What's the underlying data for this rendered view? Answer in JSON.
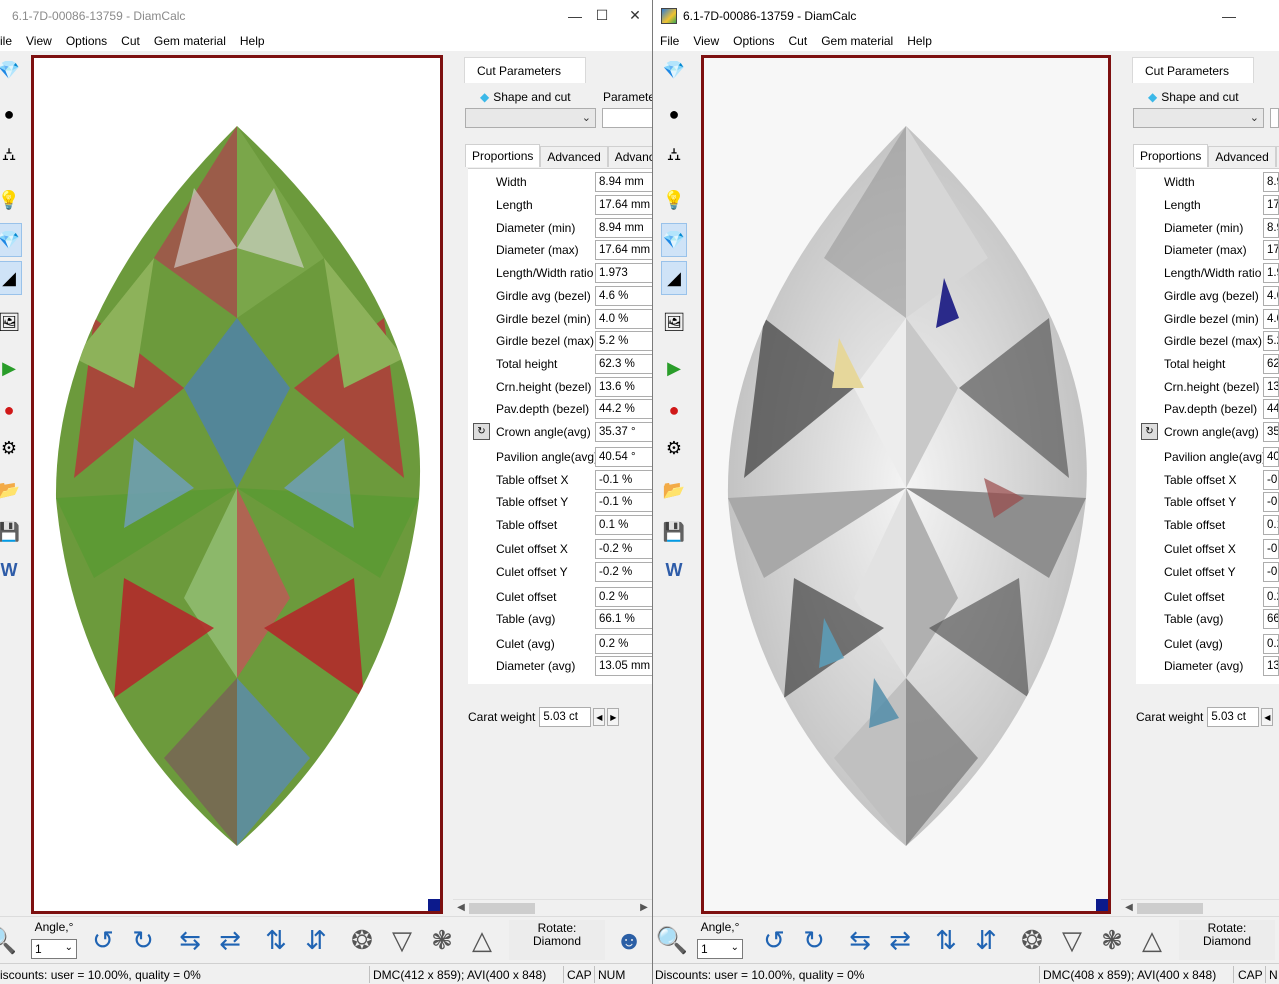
{
  "windows": [
    {
      "title": "6.1-7D-00086-13759 - DiamCalc",
      "active": false,
      "menu": [
        "ile",
        "View",
        "Options",
        "Cut",
        "Gem material",
        "Help"
      ],
      "status_left": "iscounts: user = 10.00%, quality = 0%",
      "status_dims": "DMC(412 x 859); AVI(400 x 848)",
      "status_cap": "CAP",
      "status_num": "NUM"
    },
    {
      "title": "6.1-7D-00086-13759 - DiamCalc",
      "active": true,
      "menu": [
        "File",
        "View",
        "Options",
        "Cut",
        "Gem material",
        "Help"
      ],
      "status_left": "Discounts: user = 10.00%, quality = 0%",
      "status_dims": "DMC(408 x 859); AVI(400 x 848)",
      "status_cap": "CAP",
      "status_num": "N"
    }
  ],
  "panel": {
    "tab_cut_parameters": "Cut Parameters",
    "shape_label": "Shape and cut",
    "parameters_label": "Parameter",
    "subtabs": [
      "Proportions",
      "Advanced",
      "Advanced"
    ],
    "carat_label": "Carat weight",
    "carat_value": "5.03 ct"
  },
  "proportions": [
    {
      "label": "Width",
      "value": "8.94 mm"
    },
    {
      "label": "Length",
      "value": "17.64 mm"
    },
    {
      "label": "Diameter (min)",
      "value": "8.94 mm"
    },
    {
      "label": "Diameter (max)",
      "value": "17.64 mm"
    },
    {
      "label": "Length/Width ratio",
      "value": "1.973"
    },
    {
      "label": "Girdle avg (bezel)",
      "value": "4.6 %"
    },
    {
      "label": "Girdle bezel (min)",
      "value": "4.0 %"
    },
    {
      "label": "Girdle bezel (max)",
      "value": "5.2 %"
    },
    {
      "label": "Total height",
      "value": "62.3 %"
    },
    {
      "label": "Crn.height (bezel)",
      "value": "13.6 %"
    },
    {
      "label": "Pav.depth (bezel)",
      "value": "44.2 %"
    },
    {
      "label": "Crown angle(avg)",
      "value": "35.37 °"
    },
    {
      "label": "Pavilion angle(avg)",
      "value": "40.54 °"
    },
    {
      "label": "Table offset X",
      "value": "-0.1 %"
    },
    {
      "label": "Table offset Y",
      "value": "-0.1 %"
    },
    {
      "label": "Table offset",
      "value": "0.1 %"
    },
    {
      "label": "Culet offset X",
      "value": "-0.2 %"
    },
    {
      "label": "Culet offset Y",
      "value": "-0.2 %"
    },
    {
      "label": "Culet offset",
      "value": "0.2 %"
    },
    {
      "label": "Table (avg)",
      "value": "66.1 %"
    },
    {
      "label": "Culet (avg)",
      "value": "0.2 %"
    },
    {
      "label": "Diameter (avg)",
      "value": "13.05 mm"
    }
  ],
  "bottom": {
    "angle_label": "Angle,°",
    "angle_value": "1",
    "rotate_label": "Rotate:",
    "rotate_value": "Diamond"
  },
  "icons": [
    "diamond-icon",
    "sphere-icon",
    "paint-bucket-icon",
    "light-bulb-icon",
    "diamond-view-icon",
    "spectrum-icon",
    "image-icon",
    "play-film-icon",
    "record-film-icon",
    "wheel-icon",
    "open-folder-icon",
    "save-icon",
    "word-doc-icon",
    "zoom-icon",
    "rotate-left-icon",
    "rotate-right-icon",
    "flip-h-icon",
    "flip-h2-icon",
    "flip-v-icon",
    "flip-v2-icon",
    "top-view-icon",
    "side-view-icon",
    "bottom-view-icon",
    "pavilion-view-icon",
    "person-icon"
  ],
  "colors": {
    "viewport_border": "#7d1010",
    "viewport_corner": "#0c1a8c",
    "accent_icon": "#2064b3"
  }
}
